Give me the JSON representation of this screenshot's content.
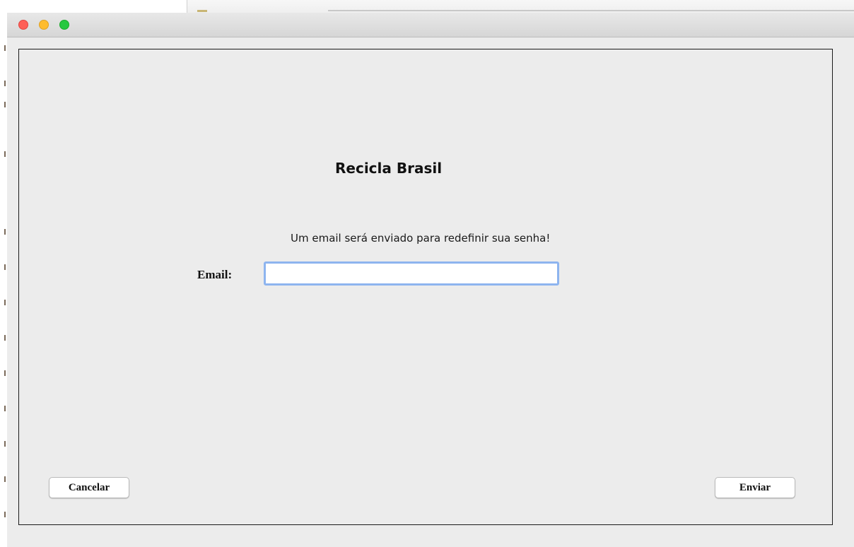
{
  "window": {
    "controls": {
      "close_icon": "close-icon",
      "minimize_icon": "minimize-icon",
      "zoom_icon": "zoom-icon"
    },
    "colors": {
      "close": "#fe5f57",
      "minimize": "#febc2e",
      "zoom": "#28c840",
      "background": "#ececec",
      "focus_ring": "#8db4ef"
    }
  },
  "form": {
    "title": "Recicla Brasil",
    "message": "Um email será enviado para redefinir sua senha!",
    "email_label": "Email:",
    "email_value": "",
    "cancel_label": "Cancelar",
    "send_label": "Enviar"
  }
}
